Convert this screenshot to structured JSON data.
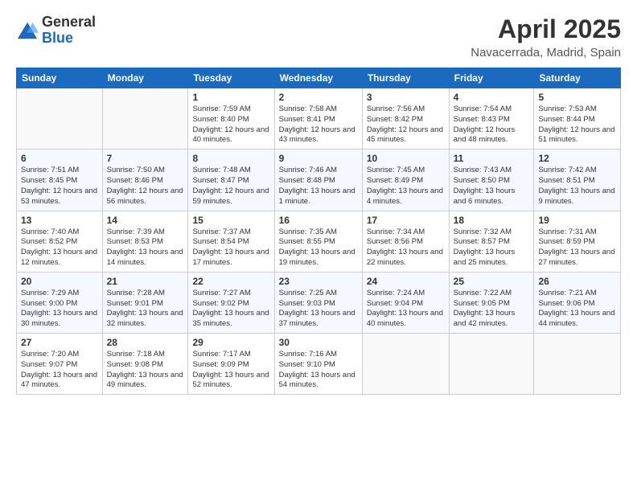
{
  "logo": {
    "general": "General",
    "blue": "Blue"
  },
  "title": "April 2025",
  "location": "Navacerrada, Madrid, Spain",
  "weekdays": [
    "Sunday",
    "Monday",
    "Tuesday",
    "Wednesday",
    "Thursday",
    "Friday",
    "Saturday"
  ],
  "weeks": [
    [
      {
        "num": "",
        "info": ""
      },
      {
        "num": "",
        "info": ""
      },
      {
        "num": "1",
        "info": "Sunrise: 7:59 AM\nSunset: 8:40 PM\nDaylight: 12 hours and 40 minutes."
      },
      {
        "num": "2",
        "info": "Sunrise: 7:58 AM\nSunset: 8:41 PM\nDaylight: 12 hours and 43 minutes."
      },
      {
        "num": "3",
        "info": "Sunrise: 7:56 AM\nSunset: 8:42 PM\nDaylight: 12 hours and 45 minutes."
      },
      {
        "num": "4",
        "info": "Sunrise: 7:54 AM\nSunset: 8:43 PM\nDaylight: 12 hours and 48 minutes."
      },
      {
        "num": "5",
        "info": "Sunrise: 7:53 AM\nSunset: 8:44 PM\nDaylight: 12 hours and 51 minutes."
      }
    ],
    [
      {
        "num": "6",
        "info": "Sunrise: 7:51 AM\nSunset: 8:45 PM\nDaylight: 12 hours and 53 minutes."
      },
      {
        "num": "7",
        "info": "Sunrise: 7:50 AM\nSunset: 8:46 PM\nDaylight: 12 hours and 56 minutes."
      },
      {
        "num": "8",
        "info": "Sunrise: 7:48 AM\nSunset: 8:47 PM\nDaylight: 12 hours and 59 minutes."
      },
      {
        "num": "9",
        "info": "Sunrise: 7:46 AM\nSunset: 8:48 PM\nDaylight: 13 hours and 1 minute."
      },
      {
        "num": "10",
        "info": "Sunrise: 7:45 AM\nSunset: 8:49 PM\nDaylight: 13 hours and 4 minutes."
      },
      {
        "num": "11",
        "info": "Sunrise: 7:43 AM\nSunset: 8:50 PM\nDaylight: 13 hours and 6 minutes."
      },
      {
        "num": "12",
        "info": "Sunrise: 7:42 AM\nSunset: 8:51 PM\nDaylight: 13 hours and 9 minutes."
      }
    ],
    [
      {
        "num": "13",
        "info": "Sunrise: 7:40 AM\nSunset: 8:52 PM\nDaylight: 13 hours and 12 minutes."
      },
      {
        "num": "14",
        "info": "Sunrise: 7:39 AM\nSunset: 8:53 PM\nDaylight: 13 hours and 14 minutes."
      },
      {
        "num": "15",
        "info": "Sunrise: 7:37 AM\nSunset: 8:54 PM\nDaylight: 13 hours and 17 minutes."
      },
      {
        "num": "16",
        "info": "Sunrise: 7:35 AM\nSunset: 8:55 PM\nDaylight: 13 hours and 19 minutes."
      },
      {
        "num": "17",
        "info": "Sunrise: 7:34 AM\nSunset: 8:56 PM\nDaylight: 13 hours and 22 minutes."
      },
      {
        "num": "18",
        "info": "Sunrise: 7:32 AM\nSunset: 8:57 PM\nDaylight: 13 hours and 25 minutes."
      },
      {
        "num": "19",
        "info": "Sunrise: 7:31 AM\nSunset: 8:59 PM\nDaylight: 13 hours and 27 minutes."
      }
    ],
    [
      {
        "num": "20",
        "info": "Sunrise: 7:29 AM\nSunset: 9:00 PM\nDaylight: 13 hours and 30 minutes."
      },
      {
        "num": "21",
        "info": "Sunrise: 7:28 AM\nSunset: 9:01 PM\nDaylight: 13 hours and 32 minutes."
      },
      {
        "num": "22",
        "info": "Sunrise: 7:27 AM\nSunset: 9:02 PM\nDaylight: 13 hours and 35 minutes."
      },
      {
        "num": "23",
        "info": "Sunrise: 7:25 AM\nSunset: 9:03 PM\nDaylight: 13 hours and 37 minutes."
      },
      {
        "num": "24",
        "info": "Sunrise: 7:24 AM\nSunset: 9:04 PM\nDaylight: 13 hours and 40 minutes."
      },
      {
        "num": "25",
        "info": "Sunrise: 7:22 AM\nSunset: 9:05 PM\nDaylight: 13 hours and 42 minutes."
      },
      {
        "num": "26",
        "info": "Sunrise: 7:21 AM\nSunset: 9:06 PM\nDaylight: 13 hours and 44 minutes."
      }
    ],
    [
      {
        "num": "27",
        "info": "Sunrise: 7:20 AM\nSunset: 9:07 PM\nDaylight: 13 hours and 47 minutes."
      },
      {
        "num": "28",
        "info": "Sunrise: 7:18 AM\nSunset: 9:08 PM\nDaylight: 13 hours and 49 minutes."
      },
      {
        "num": "29",
        "info": "Sunrise: 7:17 AM\nSunset: 9:09 PM\nDaylight: 13 hours and 52 minutes."
      },
      {
        "num": "30",
        "info": "Sunrise: 7:16 AM\nSunset: 9:10 PM\nDaylight: 13 hours and 54 minutes."
      },
      {
        "num": "",
        "info": ""
      },
      {
        "num": "",
        "info": ""
      },
      {
        "num": "",
        "info": ""
      }
    ]
  ]
}
